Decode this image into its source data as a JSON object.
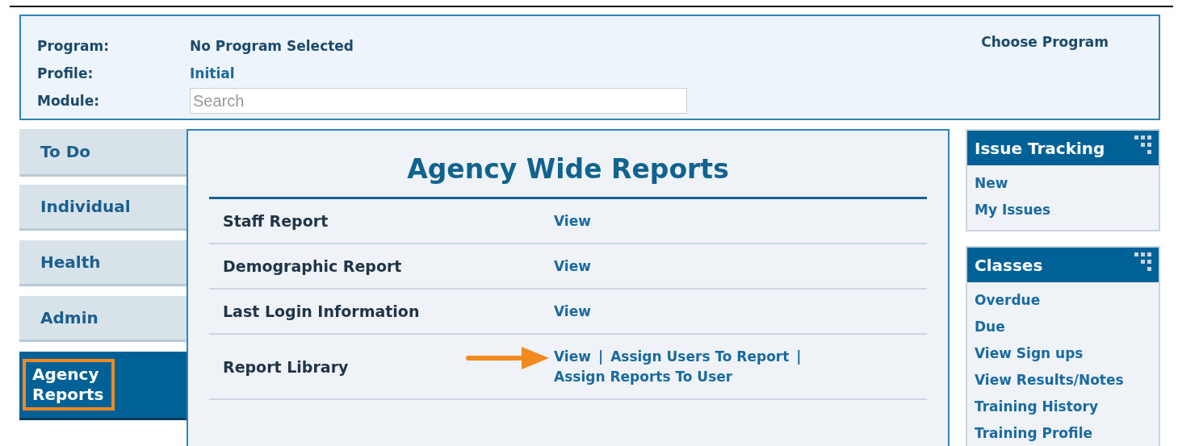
{
  "header": {
    "fields": [
      {
        "label": "Program:",
        "value": "No Program Selected",
        "kind": "text"
      },
      {
        "label": "Profile:",
        "value": "Initial",
        "kind": "link"
      },
      {
        "label": "Module:",
        "placeholder": "Search",
        "kind": "search"
      }
    ],
    "action": "Choose Program"
  },
  "nav": [
    {
      "label": "To Do",
      "selected": false,
      "highlighted": false
    },
    {
      "label": "Individual",
      "selected": false,
      "highlighted": false
    },
    {
      "label": "Health",
      "selected": false,
      "highlighted": false
    },
    {
      "label": "Admin",
      "selected": false,
      "highlighted": false
    },
    {
      "label": "Agency Reports",
      "selected": true,
      "highlighted": true
    }
  ],
  "main": {
    "title": "Agency Wide Reports",
    "rows": [
      {
        "name": "Staff Report",
        "pointer_arrow": false,
        "actions": [
          {
            "kind": "link",
            "text": "View"
          }
        ]
      },
      {
        "name": "Demographic Report",
        "pointer_arrow": false,
        "actions": [
          {
            "kind": "link",
            "text": "View"
          }
        ]
      },
      {
        "name": "Last Login Information",
        "pointer_arrow": false,
        "actions": [
          {
            "kind": "link",
            "text": "View"
          }
        ]
      },
      {
        "name": "Report Library",
        "pointer_arrow": true,
        "actions": [
          {
            "kind": "link",
            "text": "View"
          },
          {
            "kind": "separator",
            "text": "|"
          },
          {
            "kind": "link",
            "text": "Assign Users To Report"
          },
          {
            "kind": "separator",
            "text": "|"
          },
          {
            "kind": "link",
            "text": "Assign Reports To User"
          }
        ]
      }
    ]
  },
  "widgets": [
    {
      "title": "Issue Tracking",
      "links": [
        "New",
        "My Issues"
      ]
    },
    {
      "title": "Classes",
      "links": [
        "Overdue",
        "Due",
        "View Sign ups",
        "View Results/Notes",
        "Training History",
        "Training Profile"
      ]
    }
  ]
}
